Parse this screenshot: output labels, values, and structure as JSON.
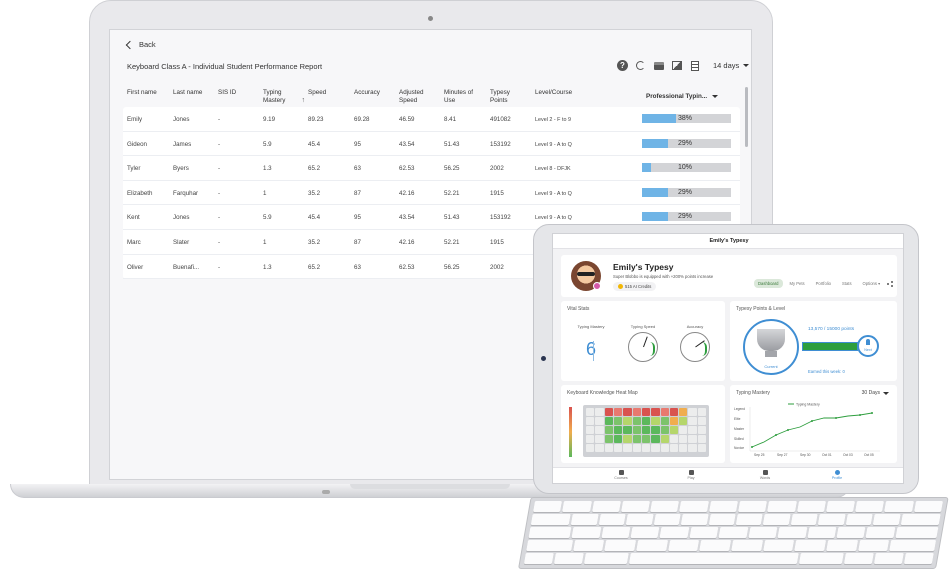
{
  "report": {
    "back_label": "Back",
    "title": "Keyboard Class A - Individual Student Performance Report",
    "date_range": "14 days",
    "columns": {
      "first_name": "First name",
      "last_name": "Last name",
      "sis_id": "SIS ID",
      "typing_mastery": "Typing Mastery",
      "speed": "Speed",
      "accuracy": "Accuracy",
      "adjusted_speed": "Adjusted Speed",
      "minutes_of_use": "Minutes of Use",
      "typesy_points": "Typesy Points",
      "level_course": "Level/Course",
      "course_filter": "Professional Typin..."
    },
    "rows": [
      {
        "first": "Emily",
        "last": "Jones",
        "sis": "-",
        "mastery": "9.19",
        "speed": "89.23",
        "accuracy": "69.28",
        "adjusted": "46.59",
        "minutes": "8.41",
        "points": "491082",
        "level": "Level 2 - F to 9",
        "progress": 38,
        "progress_label": "38%"
      },
      {
        "first": "Gideon",
        "last": "James",
        "sis": "-",
        "mastery": "5.9",
        "speed": "45.4",
        "accuracy": "95",
        "adjusted": "43.54",
        "minutes": "51.43",
        "points": "153192",
        "level": "Level 9 - A to Q",
        "progress": 29,
        "progress_label": "29%"
      },
      {
        "first": "Tyler",
        "last": "Byers",
        "sis": "-",
        "mastery": "1.3",
        "speed": "65.2",
        "accuracy": "63",
        "adjusted": "62.53",
        "minutes": "56.25",
        "points": "2002",
        "level": "Level 8 - DFJK",
        "progress": 10,
        "progress_label": "10%"
      },
      {
        "first": "Elizabeth",
        "last": "Farquhar",
        "sis": "-",
        "mastery": "1",
        "speed": "35.2",
        "accuracy": "87",
        "adjusted": "42.16",
        "minutes": "52.21",
        "points": "1915",
        "level": "Level 9 - A to Q",
        "progress": 29,
        "progress_label": "29%"
      },
      {
        "first": "Kent",
        "last": "Jones",
        "sis": "-",
        "mastery": "5.9",
        "speed": "45.4",
        "accuracy": "95",
        "adjusted": "43.54",
        "minutes": "51.43",
        "points": "153192",
        "level": "Level 9 - A to Q",
        "progress": 29,
        "progress_label": "29%"
      },
      {
        "first": "Marc",
        "last": "Slater",
        "sis": "-",
        "mastery": "1",
        "speed": "35.2",
        "accuracy": "87",
        "adjusted": "42.16",
        "minutes": "52.21",
        "points": "1915",
        "level": "",
        "progress": null,
        "progress_label": ""
      },
      {
        "first": "Oliver",
        "last": "Buenafi...",
        "sis": "-",
        "mastery": "1.3",
        "speed": "65.2",
        "accuracy": "63",
        "adjusted": "62.53",
        "minutes": "56.25",
        "points": "2002",
        "level": "",
        "progress": null,
        "progress_label": ""
      }
    ],
    "toolbar_icons": [
      "help-icon",
      "refresh-icon",
      "print-icon",
      "image-icon",
      "document-icon"
    ]
  },
  "tablet": {
    "window_title": "Emily's Typesy",
    "profile": {
      "name": "Emily's Typesy",
      "subtitle": "Super Blobbo is equipped with +200% points increase",
      "credits": "515 AI Credits",
      "tabs": [
        "Dashboard",
        "My Pets",
        "Portfolio",
        "Stats",
        "Options"
      ],
      "active_tab": "Dashboard"
    },
    "vital_stats": {
      "title": "Vital Stats",
      "mastery_label": "Typing Mastery",
      "mastery_value": "6",
      "speed_label": "Typing Speed",
      "accuracy_label": "Accuracy"
    },
    "points": {
      "title": "Typesy Points & Level",
      "value": "13,570 / 15000 points",
      "progress": 0.9,
      "current_label": "Current",
      "next_label": "Next",
      "earned": "Earned this week: 0"
    },
    "heatmap": {
      "title": "Keyboard Knowledge Heat Map"
    },
    "mastery_chart": {
      "title": "Typing Mastery",
      "range": "30 Days",
      "legend": "Typing Mastery",
      "y_levels": [
        "Legend",
        "Elite",
        "Master",
        "Skilled",
        "Novice"
      ],
      "x_ticks": [
        "Sep 25",
        "Sep 27",
        "Sep 30",
        "Oct 01",
        "Oct 03",
        "Oct 05"
      ]
    },
    "nav": [
      {
        "label": "Courses",
        "icon": "courses-icon"
      },
      {
        "label": "Play",
        "icon": "gamepad-icon"
      },
      {
        "label": "Words",
        "icon": "book-icon"
      },
      {
        "label": "Profile",
        "icon": "profile-icon",
        "active": true
      }
    ]
  },
  "colors": {
    "accent_blue": "#3f8ed3",
    "progress_blue": "#6fb4e6",
    "success_green": "#2e9e3e"
  }
}
